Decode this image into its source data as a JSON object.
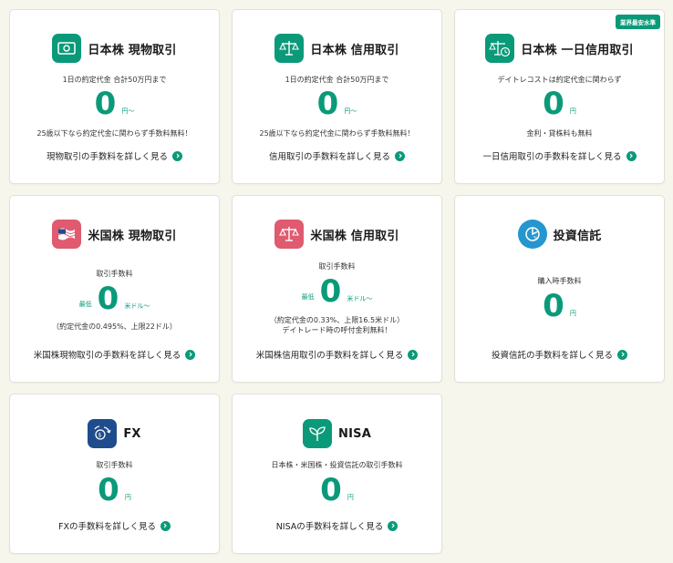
{
  "colors": {
    "accent": "#0a9a79",
    "background": "#f6f6ec",
    "us_icon": "#e05a70",
    "fx_icon": "#1f4c8c",
    "fund_icon": "#2596cf"
  },
  "cards": [
    {
      "icon": "banknote-icon",
      "title": "日本株 現物取引",
      "note_top": "1日の約定代金 合計50万円まで",
      "fee_prefix": "",
      "fee_value": "0",
      "fee_unit": "円〜",
      "note_bottom": "25歳以下なら約定代金に関わらず手数料無料！",
      "note_bottom2": "",
      "link": "現物取引の手数料を詳しく見る"
    },
    {
      "icon": "scale-icon",
      "title": "日本株 信用取引",
      "note_top": "1日の約定代金 合計50万円まで",
      "fee_prefix": "",
      "fee_value": "0",
      "fee_unit": "円〜",
      "note_bottom": "25歳以下なら約定代金に関わらず手数料無料！",
      "note_bottom2": "",
      "link": "信用取引の手数料を詳しく見る"
    },
    {
      "icon": "scale-clock-icon",
      "title": "日本株 一日信用取引",
      "badge": "業界最安水準",
      "note_top": "デイトレコストは約定代金に関わらず",
      "fee_prefix": "",
      "fee_value": "0",
      "fee_unit": "円",
      "note_bottom": "金利・貸株料も無料",
      "note_bottom2": "",
      "link": "一日信用取引の手数料を詳しく見る"
    },
    {
      "icon": "us-flag-icon",
      "title": "米国株 現物取引",
      "note_top": "取引手数料",
      "fee_prefix": "最低",
      "fee_value": "0",
      "fee_unit": "米ドル〜",
      "note_bottom": "（約定代金の0.495%、上限22ドル）",
      "note_bottom2": "",
      "link": "米国株現物取引の手数料を詳しく見る"
    },
    {
      "icon": "scale-icon",
      "title": "米国株 信用取引",
      "note_top": "取引手数料",
      "fee_prefix": "最低",
      "fee_value": "0",
      "fee_unit": "米ドル〜",
      "note_bottom": "（約定代金の0.33%、上限16.5米ドル）",
      "note_bottom2": "デイトレード時の呼付金利無料！",
      "link": "米国株信用取引の手数料を詳しく見る"
    },
    {
      "icon": "pie-chart-icon",
      "title": "投資信託",
      "note_top": "購入時手数料",
      "fee_prefix": "",
      "fee_value": "0",
      "fee_unit": "円",
      "note_bottom": "",
      "note_bottom2": "",
      "link": "投資信託の手数料を詳しく見る"
    },
    {
      "icon": "currency-exchange-icon",
      "title": "FX",
      "note_top": "取引手数料",
      "fee_prefix": "",
      "fee_value": "0",
      "fee_unit": "円",
      "note_bottom": "",
      "note_bottom2": "",
      "link": "FXの手数料を詳しく見る"
    },
    {
      "icon": "sprout-icon",
      "title": "NISA",
      "note_top": "日本株・米国株・投資信託の取引手数料",
      "fee_prefix": "",
      "fee_value": "0",
      "fee_unit": "円",
      "note_bottom": "",
      "note_bottom2": "",
      "link": "NISAの手数料を詳しく見る"
    }
  ]
}
